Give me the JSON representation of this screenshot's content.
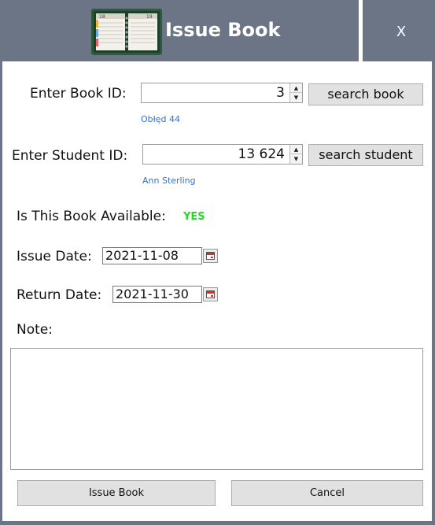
{
  "window": {
    "title": "Issue Book",
    "close_label": "X",
    "icon": "planner-book-icon",
    "colors": {
      "titlebar": "#6b7585",
      "link": "#3a6fc4",
      "available": "#22dd22"
    }
  },
  "form": {
    "book_id_label": "Enter Book ID:",
    "book_id_value": "3",
    "search_book_label": "search book",
    "book_title": "Obłęd 44",
    "student_id_label": "Enter Student ID:",
    "student_id_value": "13 624",
    "search_student_label": "search student",
    "student_name": "Ann Sterling",
    "available_label": "Is This Book Available:",
    "available_value": "YES",
    "issue_date_label": "Issue Date:",
    "issue_date_value": "2021-11-08",
    "return_date_label": "Return Date:",
    "return_date_value": "2021-11-30",
    "note_label": "Note:",
    "note_value": ""
  },
  "actions": {
    "issue_label": "Issue Book",
    "cancel_label": "Cancel"
  }
}
